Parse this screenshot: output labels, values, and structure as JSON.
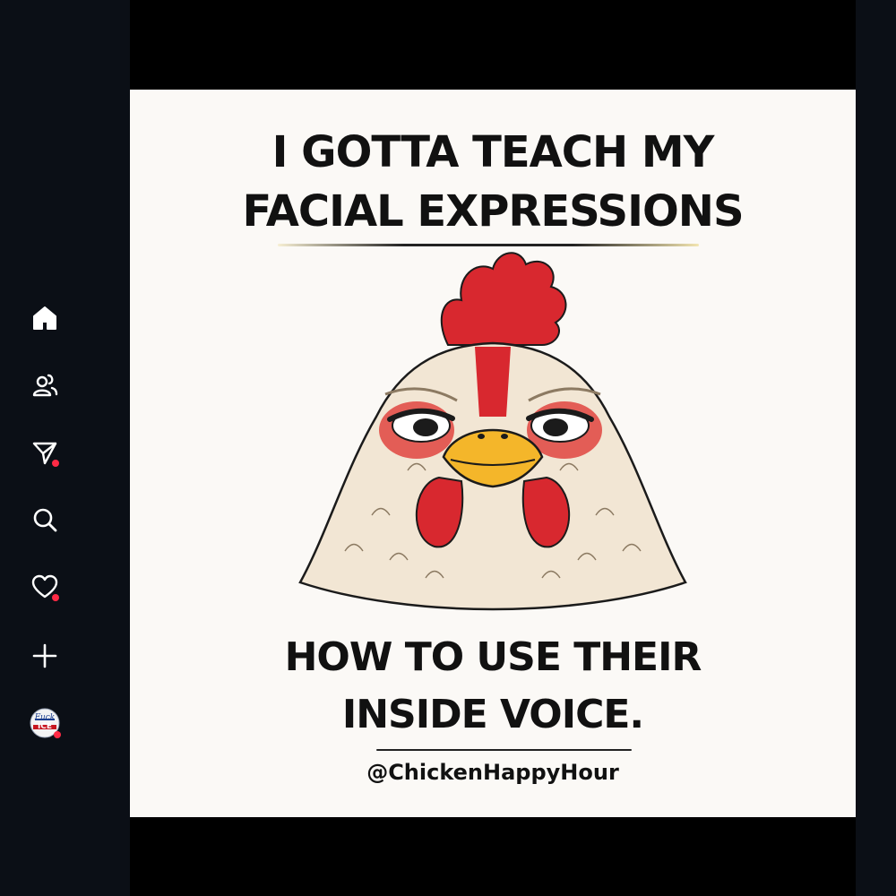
{
  "sidebar": {
    "items": [
      {
        "id": "home",
        "icon": "home-icon"
      },
      {
        "id": "friends",
        "icon": "friends-icon"
      },
      {
        "id": "messages",
        "icon": "send-icon",
        "notification": true
      },
      {
        "id": "search",
        "icon": "search-icon"
      },
      {
        "id": "activity",
        "icon": "heart-icon",
        "notification": true
      },
      {
        "id": "create",
        "icon": "plus-icon"
      },
      {
        "id": "profile",
        "icon": "avatar",
        "notification": true
      }
    ],
    "profile_badge_line1": "Fuck",
    "profile_badge_line2": "ICE"
  },
  "post": {
    "headline_top_line1": "I GOTTA TEACH MY",
    "headline_top_line2": "FACIAL EXPRESSIONS",
    "headline_bottom_line1": "HOW TO USE THEIR",
    "headline_bottom_line2": "INSIDE VOICE.",
    "handle": "@ChickenHappyHour"
  },
  "colors": {
    "background": "#0b0f16",
    "notification": "#ff2a45",
    "post_bg": "#fbf9f6",
    "accent_underline": "#e7c84a"
  }
}
